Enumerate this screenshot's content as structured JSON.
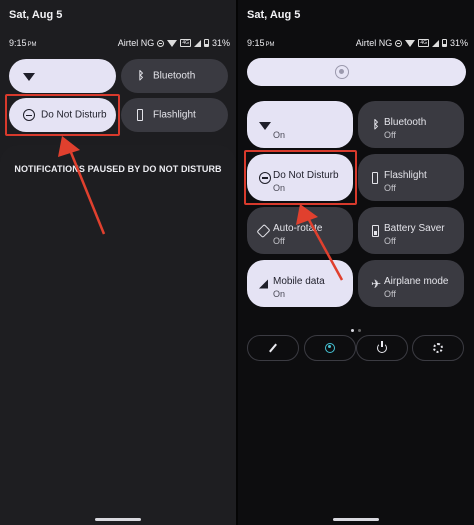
{
  "left": {
    "date": "Sat, Aug 5",
    "status": {
      "time": "9:15",
      "ampm": "PM",
      "carrier": "Airtel NG",
      "battery": "31%"
    },
    "tiles": [
      {
        "id": "wifi",
        "icon": "wifi-icon",
        "label": "",
        "state": "on"
      },
      {
        "id": "bluetooth",
        "icon": "bluetooth-icon",
        "label": "Bluetooth",
        "state": "off"
      },
      {
        "id": "dnd",
        "icon": "do-not-disturb-icon",
        "label": "Do Not Disturb",
        "state": "on"
      },
      {
        "id": "flashlight",
        "icon": "flashlight-icon",
        "label": "Flashlight",
        "state": "off"
      }
    ],
    "notice": "NOTIFICATIONS PAUSED BY DO NOT DISTURB"
  },
  "right": {
    "date": "Sat, Aug 5",
    "status": {
      "time": "9:15",
      "ampm": "PM",
      "carrier": "Airtel NG",
      "battery": "31%"
    },
    "tiles": [
      {
        "id": "wifi",
        "icon": "wifi-icon",
        "label": "",
        "sub": "On",
        "state": "on"
      },
      {
        "id": "bluetooth",
        "icon": "bluetooth-icon",
        "label": "Bluetooth",
        "sub": "Off",
        "state": "off"
      },
      {
        "id": "dnd",
        "icon": "do-not-disturb-icon",
        "label": "Do Not Disturb",
        "sub": "On",
        "state": "on"
      },
      {
        "id": "flashlight",
        "icon": "flashlight-icon",
        "label": "Flashlight",
        "sub": "Off",
        "state": "off"
      },
      {
        "id": "autorotate",
        "icon": "auto-rotate-icon",
        "label": "Auto-rotate",
        "sub": "Off",
        "state": "off"
      },
      {
        "id": "battery-saver",
        "icon": "battery-saver-icon",
        "label": "Battery Saver",
        "sub": "Off",
        "state": "off"
      },
      {
        "id": "mobile-data",
        "icon": "mobile-data-icon",
        "label": "Mobile data",
        "sub": "On",
        "state": "on"
      },
      {
        "id": "airplane",
        "icon": "airplane-icon",
        "label": "Airplane mode",
        "sub": "Off",
        "state": "off"
      }
    ],
    "controls": [
      "edit-icon",
      "account-icon",
      "power-icon",
      "settings-icon"
    ],
    "page_indicator": {
      "pages": 2,
      "current": 1
    }
  },
  "colors": {
    "tile_on": "#e5e3f4",
    "tile_off": "#3a3a41",
    "highlight": "#d83a2c",
    "account_accent": "#46c4d6"
  }
}
